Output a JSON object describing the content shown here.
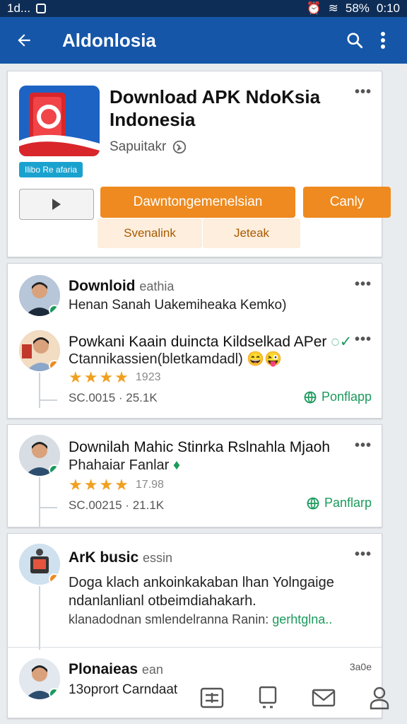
{
  "status_bar": {
    "left": "1d...",
    "battery": "58%",
    "time": "0:10"
  },
  "app_bar": {
    "title": "Aldonlosia"
  },
  "app_card": {
    "title": "Download APK NdoKsia Indonesia",
    "publisher": "Sapuitakr",
    "tag": "Ilibo Re afaria",
    "download_label": "Dawntongemenelsian",
    "secondary_label": "Canly",
    "chip1": "Svenalink",
    "chip2": "Jeteak"
  },
  "posts": [
    {
      "name": "Downloid",
      "handle": "eathia",
      "text": "Henan Sanah Uakemiheaka Kemko)"
    },
    {
      "name": "Powkani Kaain duincta Kildselkad APer",
      "text": "Ctannikassien(bletkamdadl)",
      "rating": "1923",
      "meta": "SC.0015 · 25.1K",
      "share": "Ponflapp"
    },
    {
      "name": "Downilah Mahic Stinrka Rslnahla Mjaoh",
      "text": "Phahaiar Fanlar",
      "rating": "17.98",
      "meta": "SC.00215 · 21.1K",
      "share": "Panflarp"
    },
    {
      "name": "ArK busic",
      "handle": "essin",
      "text": "Doga klach ankoinkakaban lhan Yolngaige ndanlanlianl otbeimdiahakarh.",
      "subtext": "klanadodnan smlendelranna Ranin:",
      "link": "gerhtglna.."
    },
    {
      "name": "Plonaieas",
      "handle": "ean",
      "text": "13oprort Carndaat",
      "time": "3a0e"
    }
  ],
  "colors": {
    "appbar": "#1556a8",
    "accent": "#ee8a1f",
    "green": "#1b9a5c"
  }
}
